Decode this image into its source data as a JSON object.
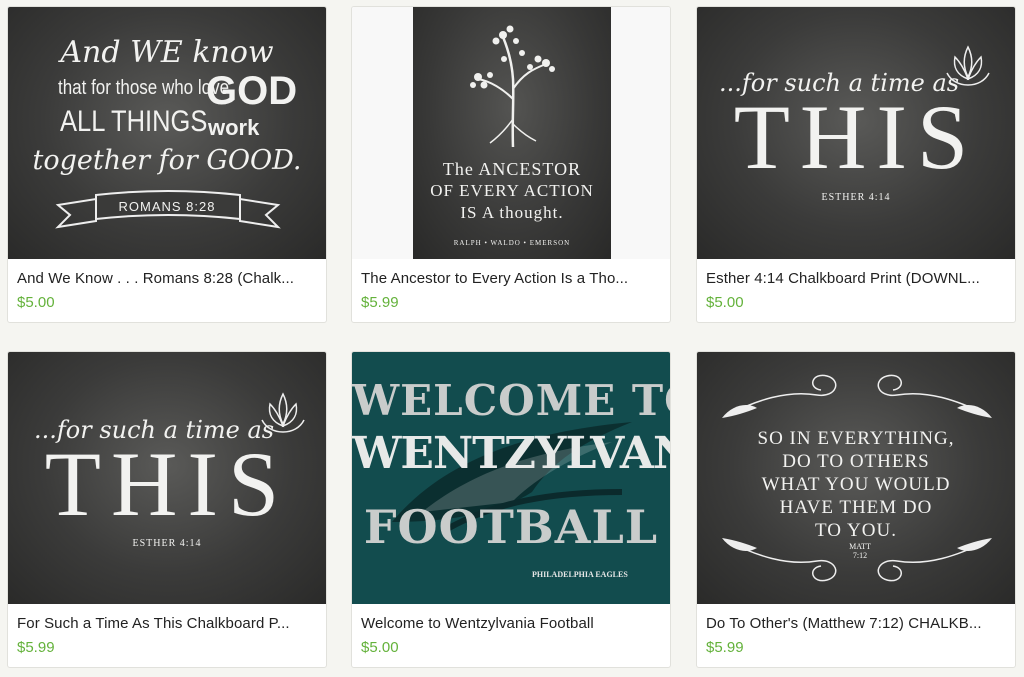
{
  "products": [
    {
      "title": "And We Know . . . Romans 8:28 (Chalk...",
      "price": "$5.00",
      "art": {
        "line1": "And WE know",
        "line2": "that for those who love",
        "line2b": "GOD",
        "line3": "ALL THINGS",
        "line3b": "work",
        "line4": "together for GOOD.",
        "banner": "ROMANS 8:28"
      }
    },
    {
      "title": "The Ancestor to Every Action Is a Tho...",
      "price": "$5.99",
      "art": {
        "line1": "The ANCESTOR",
        "line2": "OF EVERY ACTION",
        "line3": "IS A thought.",
        "author": "RALPH • WALDO • EMERSON"
      }
    },
    {
      "title": "Esther 4:14 Chalkboard Print (DOWNL...",
      "price": "$5.00",
      "art": {
        "script": "...for such a time as",
        "big": "THIS",
        "ref": "ESTHER 4:14"
      }
    },
    {
      "title": "For Such a Time As This Chalkboard P...",
      "price": "$5.99",
      "art": {
        "script": "...for such a time as",
        "big": "THIS",
        "ref": "ESTHER 4:14"
      }
    },
    {
      "title": "Welcome to Wentzylvania Football",
      "price": "$5.00",
      "art": {
        "line1": "WELCOME TO",
        "line2": "WENTZYLVANIA",
        "line3": "FOOTBALL",
        "team": "PHILADELPHIA EAGLES"
      }
    },
    {
      "title": "Do To Other's (Matthew 7:12) CHALKB...",
      "price": "$5.99",
      "art": {
        "line1": "SO IN EVERYTHING,",
        "line2": "DO TO OTHERS",
        "line3": "WHAT YOU WOULD",
        "line4": "HAVE THEM DO",
        "line5": "TO YOU.",
        "ref1": "MATT",
        "ref2": "7:12"
      }
    }
  ],
  "colors": {
    "price": "#64b23b",
    "title": "#222222",
    "eagles_green": "#124c4e"
  }
}
